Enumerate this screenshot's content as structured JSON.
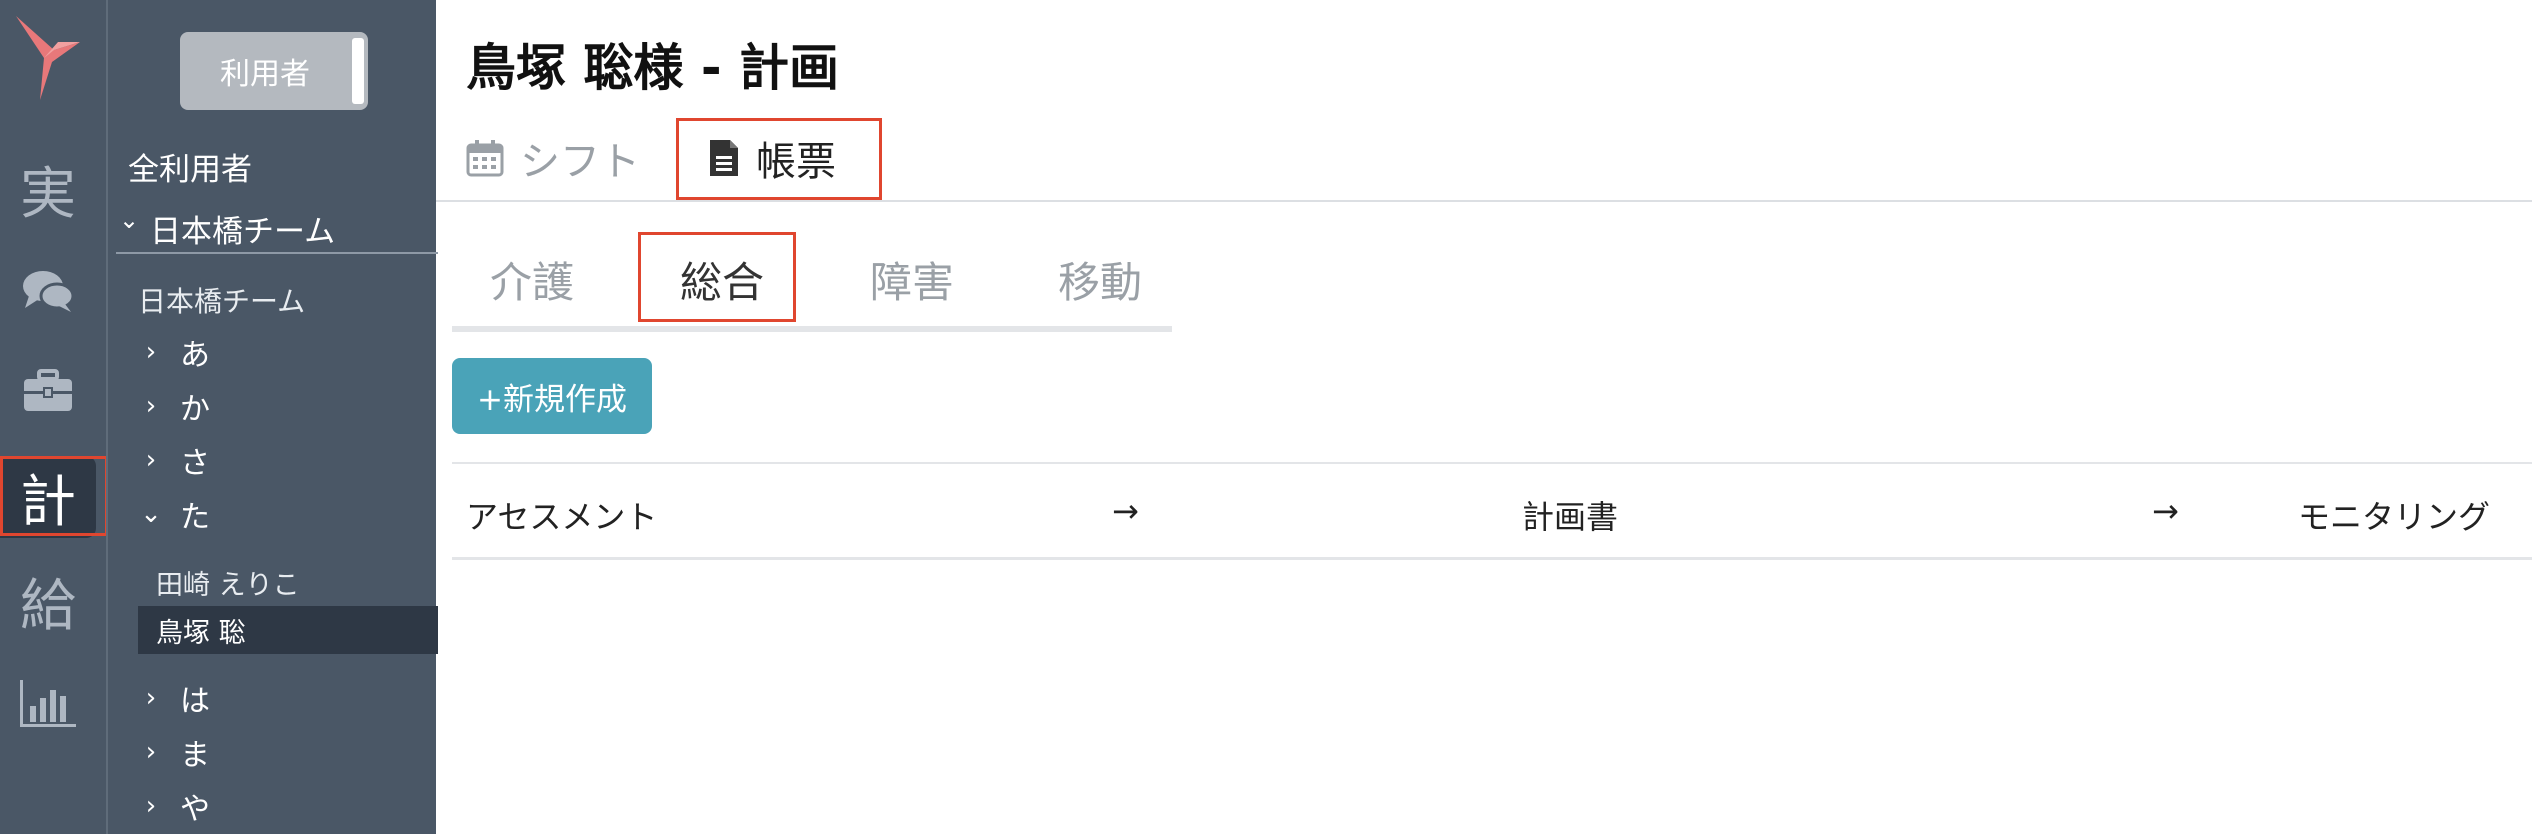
{
  "colors": {
    "rail_bg": "#4a5766",
    "rail_active": "#2e3845",
    "highlight_box": "#e0462f",
    "primary_button": "#4aa3b8",
    "toggle_bg": "#b4b9bf"
  },
  "rail": {
    "logo_icon": "hummingbird-logo",
    "items": [
      {
        "label": "実",
        "active": false
      },
      {
        "icon": "chat-bubbles-icon",
        "active": false
      },
      {
        "icon": "briefcase-icon",
        "active": false
      },
      {
        "label": "計",
        "active": true
      },
      {
        "label": "給",
        "active": false
      },
      {
        "icon": "bar-chart-icon",
        "active": false
      }
    ]
  },
  "sidebar": {
    "toggle_label": "利用者",
    "all_users": "全利用者",
    "team_header": "日本橋チーム",
    "team_sub": "日本橋チーム",
    "kana_groups": [
      {
        "label": "あ",
        "expanded": false
      },
      {
        "label": "か",
        "expanded": false
      },
      {
        "label": "さ",
        "expanded": false
      },
      {
        "label": "た",
        "expanded": true
      },
      {
        "label": "は",
        "expanded": false
      },
      {
        "label": "ま",
        "expanded": false
      },
      {
        "label": "や",
        "expanded": false
      }
    ],
    "people": [
      {
        "name": "田崎 えりこ",
        "active": false
      },
      {
        "name": "鳥塚 聡",
        "active": true
      }
    ]
  },
  "main": {
    "title": "鳥塚 聡様 - 計画",
    "top_tabs": [
      {
        "label": "シフト",
        "icon": "calendar-icon",
        "active": false
      },
      {
        "label": "帳票",
        "icon": "document-icon",
        "active": true
      }
    ],
    "sub_tabs": [
      {
        "label": "介護",
        "active": false
      },
      {
        "label": "総合",
        "active": true
      },
      {
        "label": "障害",
        "active": false
      },
      {
        "label": "移動",
        "active": false
      }
    ],
    "new_button": "+新規作成",
    "flow": {
      "step1": "アセスメント",
      "arrow1": "→",
      "step2": "計画書",
      "arrow2": "→",
      "step3": "モニタリング"
    }
  }
}
